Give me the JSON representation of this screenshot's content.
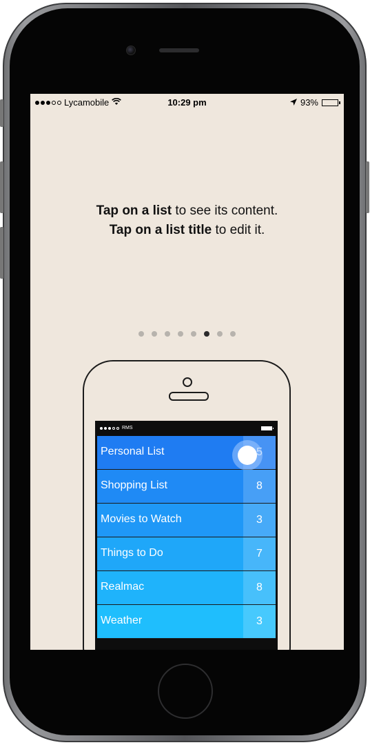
{
  "status_bar": {
    "carrier": "Lycamobile",
    "time": "10:29 pm",
    "battery": "93%",
    "signal_filled": 3,
    "signal_total": 5,
    "icons": [
      "wifi-icon",
      "location-arrow-icon",
      "battery-icon"
    ]
  },
  "instructions": {
    "line1_bold": "Tap on a list",
    "line1_rest": " to see its content.",
    "line2_bold": "Tap on a list title",
    "line2_rest": " to edit it."
  },
  "pager": {
    "count": 8,
    "active_index": 5
  },
  "illustration": {
    "carrier": "RMS",
    "lists": [
      {
        "label": "Personal List",
        "count": "5",
        "color": "#1f7cf2"
      },
      {
        "label": "Shopping List",
        "count": "8",
        "color": "#1f8af5"
      },
      {
        "label": "Movies to Watch",
        "count": "3",
        "color": "#1f98f7"
      },
      {
        "label": "Things to Do",
        "count": "7",
        "color": "#1fa7f9"
      },
      {
        "label": "Realmac",
        "count": "8",
        "color": "#1fb3fb"
      },
      {
        "label": "Weather",
        "count": "3",
        "color": "#1fbefd"
      }
    ]
  },
  "colors": {
    "screen_background": "#efe7dd",
    "device_bezel": "#050505"
  }
}
